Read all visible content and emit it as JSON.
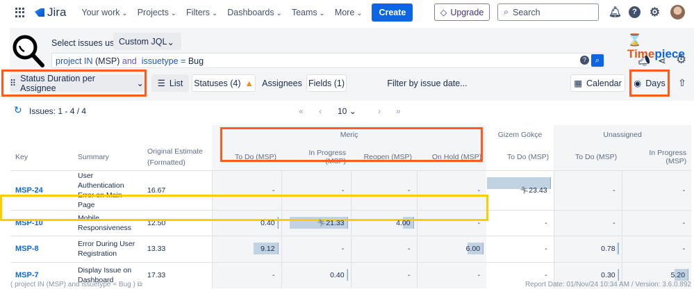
{
  "nav": {
    "product": "Jira",
    "items": [
      "Your work",
      "Projects",
      "Filters",
      "Dashboards",
      "Teams",
      "More"
    ],
    "create": "Create",
    "upgrade": "Upgrade",
    "search_placeholder": "Search"
  },
  "query": {
    "select_label": "Select issues using",
    "mode": "Custom JQL",
    "jql": {
      "p1": "project",
      "p2": "IN",
      "p3": "(MSP)",
      "p4": "and",
      "p5": "issuetype",
      "p6": "=",
      "p7": "Bug"
    }
  },
  "brand": {
    "a": "Time",
    "b": "piece"
  },
  "toolbar": {
    "report": "Status Duration per Assignee",
    "list": "List",
    "statuses": "Statuses (4)",
    "assignees": "Assignees",
    "fields": "Fields (1)",
    "filter": "Filter by issue date...",
    "calendar": "Calendar",
    "days": "Days"
  },
  "pagination": {
    "issues": "Issues: 1 - 4 / 4",
    "page_size": "10"
  },
  "table": {
    "headers": {
      "key": "Key",
      "summary": "Summary",
      "estimate": "Original Estimate (Formatted)"
    },
    "groups": [
      "Meriç",
      "Gizem Gökçe",
      "Unassigned"
    ],
    "columns": [
      "To Do (MSP)",
      "In Progress (MSP)",
      "Reopen (MSP)",
      "On Hold (MSP)",
      "To Do (MSP)",
      "To Do (MSP)",
      "In Progress (MSP)"
    ],
    "max_value": 23.43,
    "rows": [
      {
        "key": "MSP-24",
        "summary": "User Authentication Error on Main Page",
        "estimate": "16.67",
        "values": [
          "-",
          "-",
          "-",
          "-",
          "23.43",
          "-",
          "-"
        ],
        "running": [
          4
        ]
      },
      {
        "key": "MSP-10",
        "summary": "Mobile Responsiveness",
        "estimate": "12.50",
        "values": [
          "0.40",
          "21.33",
          "4.00",
          "-",
          "-",
          "-",
          "-"
        ],
        "running": [
          1
        ]
      },
      {
        "key": "MSP-8",
        "summary": "Error During User Registration",
        "estimate": "13.33",
        "values": [
          "9.12",
          "-",
          "-",
          "6.00",
          "-",
          "0.78",
          "-"
        ],
        "running": []
      },
      {
        "key": "MSP-7",
        "summary": "Display Issue on Dashboard",
        "estimate": "17.33",
        "values": [
          "-",
          "0.40",
          "-",
          "-",
          "-",
          "0.30",
          "5.20"
        ],
        "running": []
      }
    ]
  },
  "footer": {
    "query": "( project IN (MSP) and issuetype = Bug )",
    "report": "Report Date: 01/Nov/24 10:34 AM / Version: 3.6.0.892"
  },
  "colors": {
    "accent": "#0c66e4",
    "highlight_orange": "#ff5a1f",
    "highlight_yellow": "#ffcc00",
    "bar": "#c1d3e3"
  }
}
